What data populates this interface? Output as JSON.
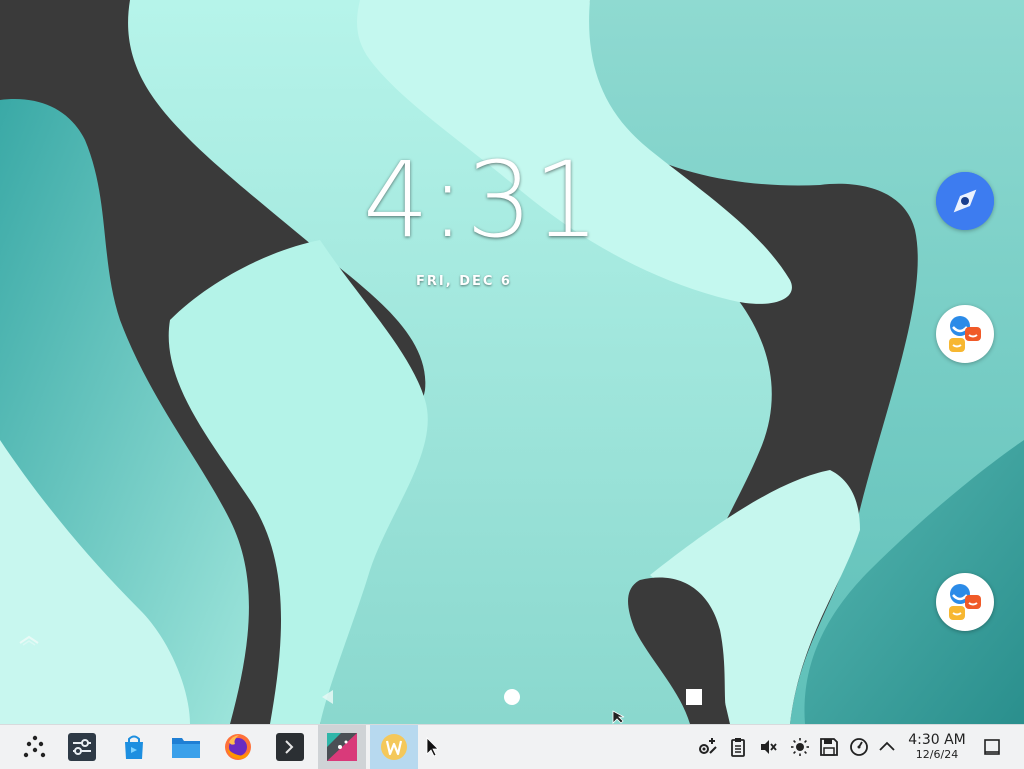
{
  "lockscreen": {
    "time": "4:31",
    "date": "FRI, DEC 6"
  },
  "floating_apps": [
    {
      "icon": "compass-navigation-icon",
      "color": "#3d7cf0"
    },
    {
      "icon": "chat-bubbles-icon"
    },
    {
      "icon": "chat-bubbles-icon"
    }
  ],
  "android_nav": [
    "back-icon",
    "home-icon",
    "recents-icon"
  ],
  "taskbar": {
    "apps": [
      "app-launcher-icon",
      "settings-sliders-icon",
      "store-bag-icon",
      "file-manager-icon",
      "firefox-icon",
      "terminal-icon",
      "android-app-icon",
      "waydroid-icon"
    ],
    "tray": [
      "network-icon",
      "clipboard-icon",
      "volume-muted-icon",
      "brightness-icon",
      "disks-icon",
      "performance-gauge-icon",
      "expand-tray-icon"
    ],
    "clock": {
      "time": "4:30 AM",
      "date": "12/6/24"
    }
  },
  "colors": {
    "dark_shape": "#3a3a3a",
    "mint_light": "#b8f5ec",
    "teal_mid": "#7fcfc6",
    "teal_dark": "#2e9b98",
    "taskbar_bg": "#f1f2f3"
  }
}
